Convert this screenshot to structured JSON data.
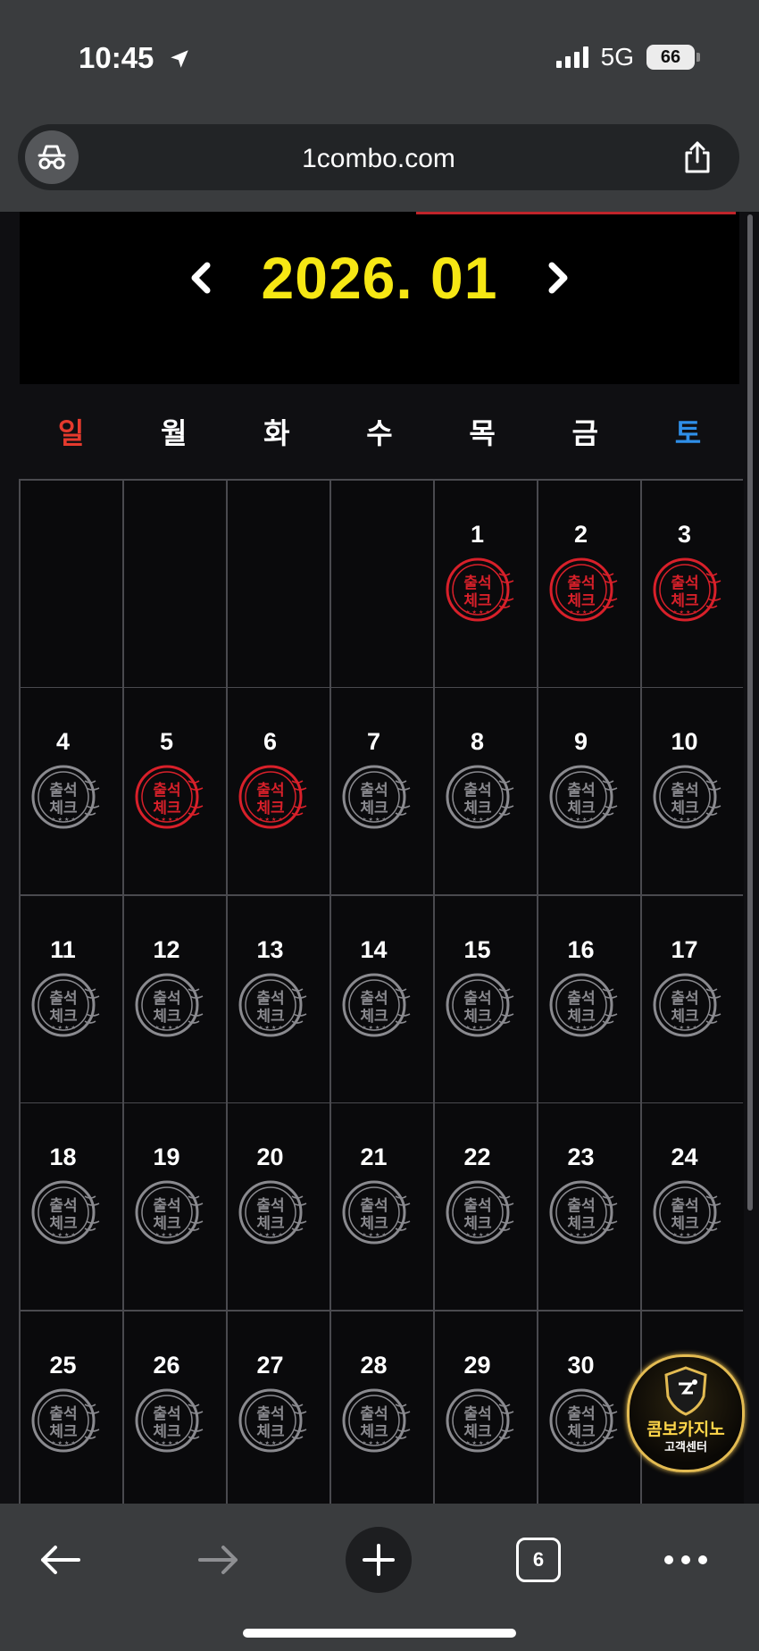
{
  "status": {
    "time": "10:45",
    "network": "5G",
    "battery": "66"
  },
  "browser": {
    "url": "1combo.com",
    "tab_count": "6"
  },
  "calendar": {
    "title": "2026. 01",
    "weekdays": [
      "일",
      "월",
      "화",
      "수",
      "목",
      "금",
      "토"
    ],
    "leading_blanks": 4,
    "stamp_text": {
      "line1": "출석",
      "line2": "체크"
    },
    "days": [
      {
        "day": "1",
        "checked": true
      },
      {
        "day": "2",
        "checked": true
      },
      {
        "day": "3",
        "checked": true
      },
      {
        "day": "4",
        "checked": false
      },
      {
        "day": "5",
        "checked": true
      },
      {
        "day": "6",
        "checked": true
      },
      {
        "day": "7",
        "checked": false
      },
      {
        "day": "8",
        "checked": false
      },
      {
        "day": "9",
        "checked": false
      },
      {
        "day": "10",
        "checked": false
      },
      {
        "day": "11",
        "checked": false
      },
      {
        "day": "12",
        "checked": false
      },
      {
        "day": "13",
        "checked": false
      },
      {
        "day": "14",
        "checked": false
      },
      {
        "day": "15",
        "checked": false
      },
      {
        "day": "16",
        "checked": false
      },
      {
        "day": "17",
        "checked": false
      },
      {
        "day": "18",
        "checked": false
      },
      {
        "day": "19",
        "checked": false
      },
      {
        "day": "20",
        "checked": false
      },
      {
        "day": "21",
        "checked": false
      },
      {
        "day": "22",
        "checked": false
      },
      {
        "day": "23",
        "checked": false
      },
      {
        "day": "24",
        "checked": false
      },
      {
        "day": "25",
        "checked": false
      },
      {
        "day": "26",
        "checked": false
      },
      {
        "day": "27",
        "checked": false
      },
      {
        "day": "28",
        "checked": false
      },
      {
        "day": "29",
        "checked": false
      },
      {
        "day": "30",
        "checked": false
      }
    ]
  },
  "support": {
    "title": "콤보카지노",
    "subtitle": "고객센터"
  },
  "colors": {
    "accent_yellow": "#f6e714",
    "stamp_red": "#d8202a",
    "stamp_gray": "#8a8a8f",
    "sunday": "#e53a2d",
    "saturday": "#2f8fe8"
  }
}
